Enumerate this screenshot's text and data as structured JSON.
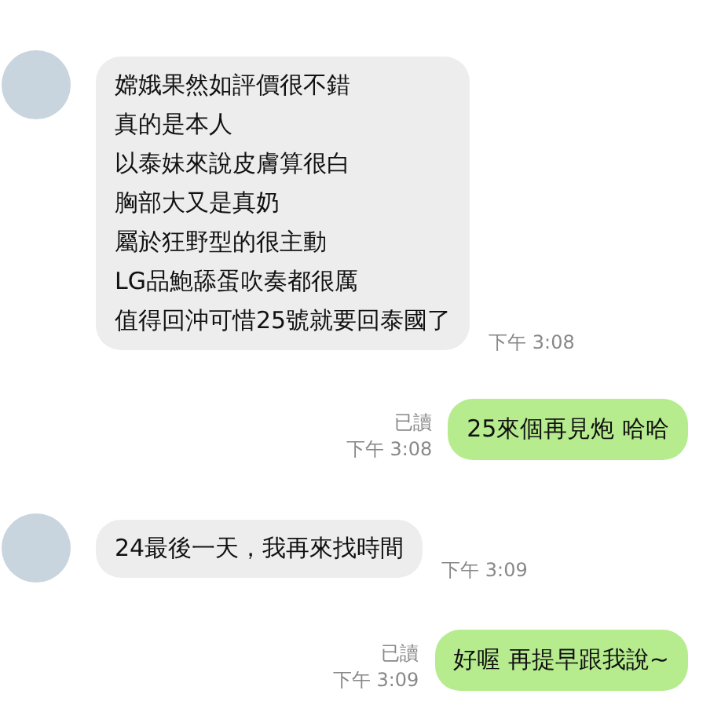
{
  "messages": [
    {
      "kind": "incoming",
      "lines": [
        "嫦娥果然如評價很不錯",
        "真的是本人",
        "以泰妹來說皮膚算很白",
        "胸部大又是真奶",
        "屬於狂野型的很主動",
        "LG品鮑舔蛋吹奏都很厲",
        "值得回沖可惜25號就要回泰國了"
      ],
      "time": "下午 3:08"
    },
    {
      "kind": "outgoing",
      "lines": [
        "25來個再見炮 哈哈"
      ],
      "read": "已讀",
      "time": "下午 3:08"
    },
    {
      "kind": "incoming",
      "lines": [
        "24最後一天，我再來找時間"
      ],
      "time": "下午 3:09"
    },
    {
      "kind": "outgoing",
      "lines": [
        "好喔 再提早跟我說~"
      ],
      "read": "已讀",
      "time": "下午 3:09"
    }
  ]
}
